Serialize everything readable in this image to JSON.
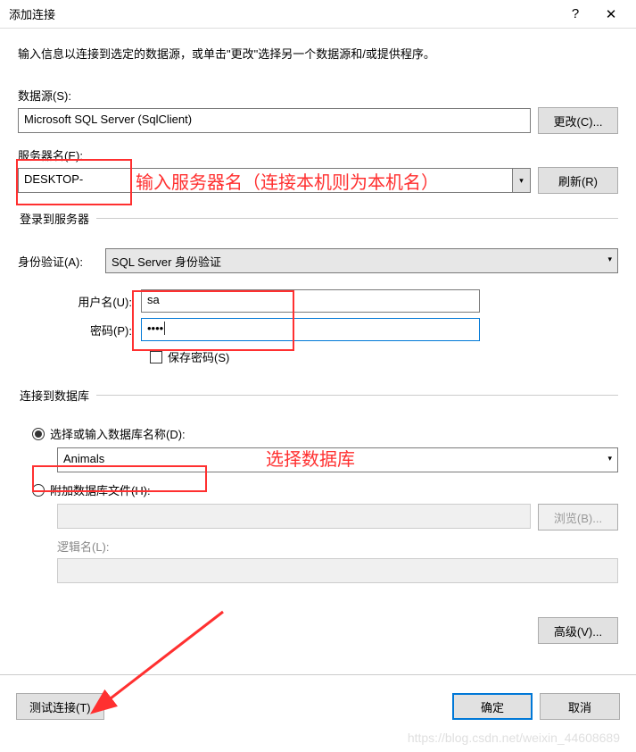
{
  "titlebar": {
    "title": "添加连接",
    "help": "?",
    "close": "✕"
  },
  "instruction": "输入信息以连接到选定的数据源，或单击\"更改\"选择另一个数据源和/或提供程序。",
  "dataSource": {
    "label": "数据源(S):",
    "value": "Microsoft SQL Server (SqlClient)",
    "changeBtn": "更改(C)..."
  },
  "serverName": {
    "label": "服务器名(E):",
    "value": "DESKTOP-",
    "refreshBtn": "刷新(R)"
  },
  "loginSection": {
    "legend": "登录到服务器",
    "authLabel": "身份验证(A):",
    "authValue": "SQL Server 身份验证",
    "userLabel": "用户名(U):",
    "userValue": "sa",
    "passLabel": "密码(P):",
    "passValue": "••••",
    "savePassLabel": "保存密码(S)"
  },
  "dbSection": {
    "legend": "连接到数据库",
    "radioSelect": "选择或输入数据库名称(D):",
    "dbValue": "Animals",
    "radioAttach": "附加数据库文件(H):",
    "browseBtn": "浏览(B)...",
    "logicalLabel": "逻辑名(L):"
  },
  "buttons": {
    "advanced": "高级(V)...",
    "test": "测试连接(T)",
    "ok": "确定",
    "cancel": "取消"
  },
  "annotations": {
    "serverHint": "输入服务器名（连接本机则为本机名）",
    "dbHint": "选择数据库"
  },
  "watermark": "https://blog.csdn.net/weixin_44608689"
}
